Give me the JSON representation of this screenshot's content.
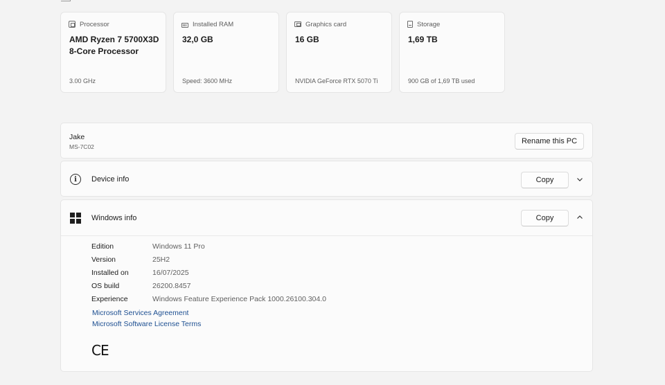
{
  "specs": [
    {
      "icon": "processor-icon",
      "label": "Processor",
      "value": "AMD Ryzen 7 5700X3D 8-Core Processor",
      "detail": "3.00 GHz"
    },
    {
      "icon": "ram-icon",
      "label": "Installed RAM",
      "value": "32,0 GB",
      "detail": "Speed: 3600 MHz"
    },
    {
      "icon": "graphics-card-icon",
      "label": "Graphics card",
      "value": "16 GB",
      "detail": "NVIDIA GeForce RTX 5070 Ti"
    },
    {
      "icon": "storage-icon",
      "label": "Storage",
      "value": "1,69 TB",
      "detail": "900 GB of 1,69 TB used"
    }
  ],
  "pc": {
    "name": "Jake",
    "model": "MS-7C02",
    "rename_label": "Rename this PC"
  },
  "device_info": {
    "title": "Device info",
    "copy_label": "Copy",
    "icon": "info-icon",
    "expanded": false
  },
  "windows_info": {
    "title": "Windows info",
    "copy_label": "Copy",
    "icon": "windows-logo-icon",
    "expanded": true,
    "rows": [
      {
        "key": "Edition",
        "value": "Windows 11 Pro"
      },
      {
        "key": "Version",
        "value": "25H2"
      },
      {
        "key": "Installed on",
        "value": "16/07/2025"
      },
      {
        "key": "OS build",
        "value": "26200.8457"
      },
      {
        "key": "Experience",
        "value": "Windows Feature Experience Pack 1000.26100.304.0"
      }
    ],
    "links": [
      "Microsoft Services Agreement",
      "Microsoft Software License Terms"
    ],
    "ce_mark": "CE"
  }
}
